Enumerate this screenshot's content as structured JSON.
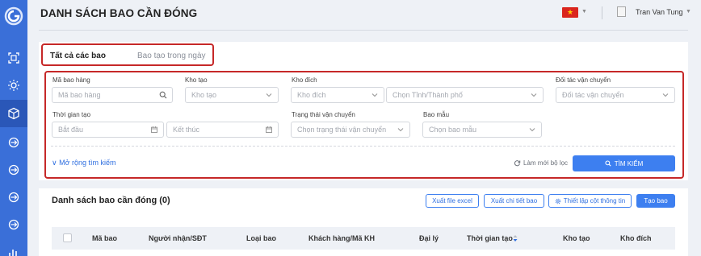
{
  "sidebar": {
    "logo_icon": "brand-logo-icon",
    "items": [
      {
        "icon": "scan-icon",
        "active": false
      },
      {
        "icon": "sun-icon",
        "active": false
      },
      {
        "icon": "package-icon",
        "active": true
      },
      {
        "icon": "cycle-icon",
        "active": false
      },
      {
        "icon": "cycle-icon",
        "active": false
      },
      {
        "icon": "cycle-icon",
        "active": false
      },
      {
        "icon": "cycle-icon",
        "active": false
      },
      {
        "icon": "chart-icon",
        "active": false
      }
    ]
  },
  "header": {
    "title": "DANH SÁCH BAO CẦN ĐÓNG",
    "language_flag": "vietnam-flag-icon",
    "user_name": "Tran Van Tung"
  },
  "tabs": {
    "all": "Tất cả các bao",
    "today": "Bao tạo trong ngày"
  },
  "filters": {
    "bag_code": {
      "label": "Mã bao hàng",
      "placeholder": "Mã bao hàng"
    },
    "origin_warehouse": {
      "label": "Kho tạo",
      "placeholder": "Kho tạo"
    },
    "destination_warehouse": {
      "label": "Kho đích",
      "placeholder": "Kho đích"
    },
    "province": {
      "placeholder": "Chọn Tỉnh/Thành phố"
    },
    "carrier": {
      "label": "Đối tác vận chuyển",
      "placeholder": "Đối tác vận chuyển"
    },
    "created_time": {
      "label": "Thời gian tạo",
      "start_placeholder": "Bắt đầu",
      "end_placeholder": "Kết thúc"
    },
    "shipping_status": {
      "label": "Trạng thái vận chuyển",
      "placeholder": "Chọn trạng thái vận chuyển"
    },
    "bag_template": {
      "label": "Bao mẫu",
      "placeholder": "Chọn bao mẫu"
    },
    "expand_link": "Mở rộng tìm kiếm",
    "reset_label": "Làm mới bộ lọc",
    "search_button": "TÌM KIẾM"
  },
  "list": {
    "title": "Danh sách bao cần đóng (0)",
    "export_excel": "Xuất file excel",
    "export_detail": "Xuất chi tiết bao",
    "column_settings": "Thiết lập cột thông tin",
    "create_bag": "Tạo bao",
    "columns": [
      "Mã bao",
      "Người nhận/SĐT",
      "Loại bao",
      "Khách hàng/Mã KH",
      "Đại lý",
      "Thời gian tạo",
      "Kho tạo",
      "Kho đích"
    ]
  },
  "colors": {
    "sidebar": "#3a6fd8",
    "sidebar_active": "#2a57b8",
    "primary": "#3d7ff0",
    "highlight_border": "#c62828"
  }
}
